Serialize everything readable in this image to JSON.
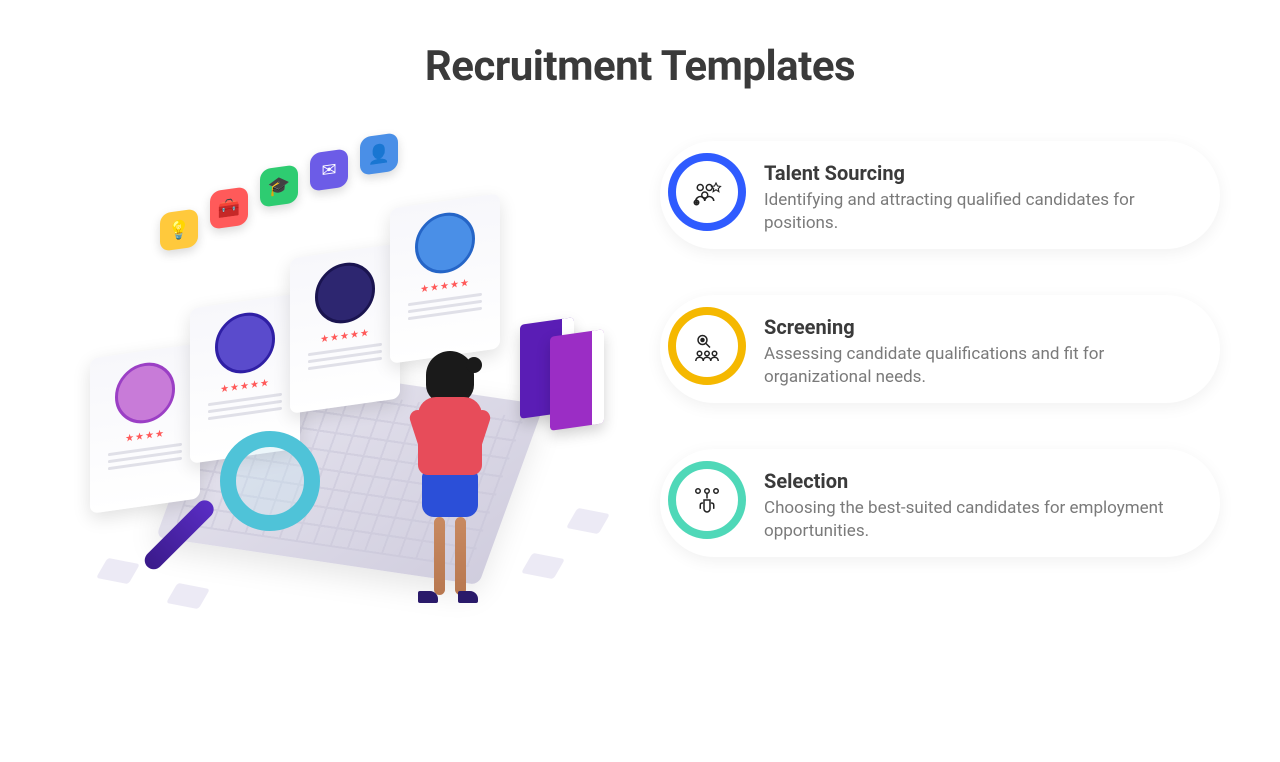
{
  "title": "Recruitment Templates",
  "colors": {
    "ring1": "#2f5bff",
    "ring2": "#f5b800",
    "ring3": "#4fd8b8"
  },
  "cards": [
    {
      "icon": "talent-sourcing-icon",
      "heading": "Talent Sourcing",
      "body": "Identifying and attracting qualified candidates for positions."
    },
    {
      "icon": "screening-icon",
      "heading": "Screening",
      "body": "Assessing candidate qualifications and fit for organizational needs."
    },
    {
      "icon": "selection-icon",
      "heading": "Selection",
      "body": "Choosing the best-suited candidates for employment opportunities."
    }
  ]
}
